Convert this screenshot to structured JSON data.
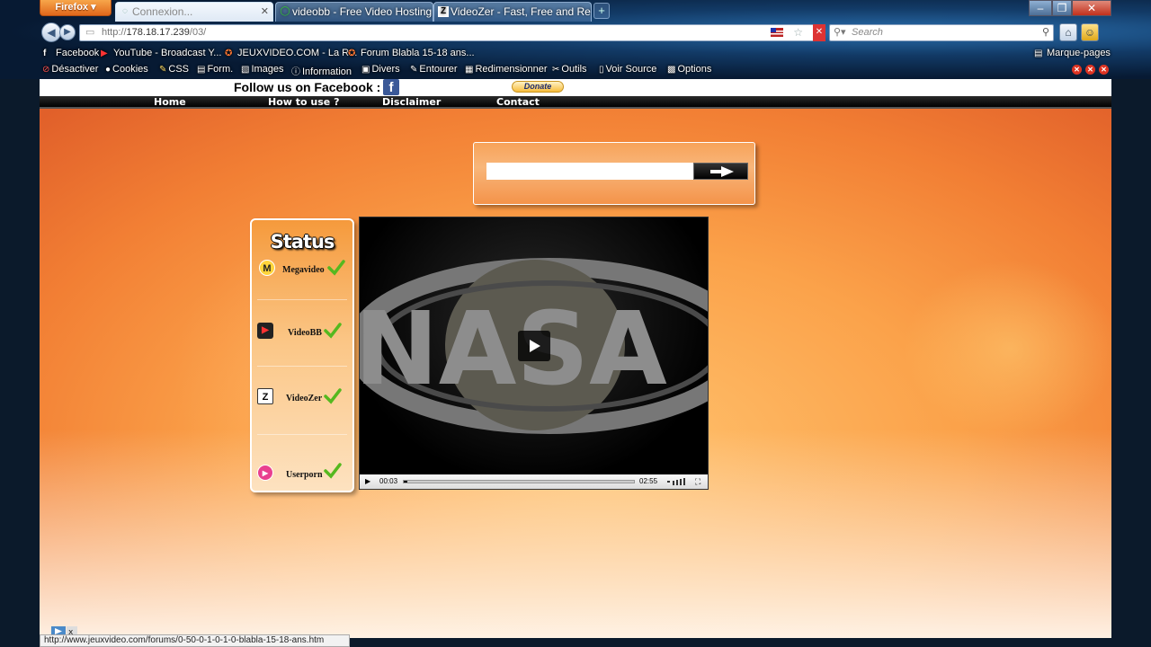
{
  "browser": {
    "app_button": "Firefox",
    "tabs": [
      {
        "title": "Connexion...",
        "icon": "loading-icon",
        "active": true
      },
      {
        "title": "videobb - Free Video Hosting...",
        "icon": "videobb-icon",
        "active": false
      },
      {
        "title": "VideoZer - Fast, Free and Reli...",
        "icon": "videozer-icon",
        "active": false
      }
    ],
    "url_prefix": "http://",
    "url_host": "178.18.17.239",
    "url_path": "/03/",
    "search_placeholder": "Search",
    "bookmarks": [
      {
        "label": "Facebook",
        "icon": "facebook-icon"
      },
      {
        "label": "YouTube - Broadcast Y...",
        "icon": "youtube-icon"
      },
      {
        "label": "JEUXVIDEO.COM - La R...",
        "icon": "jeuxvideo-icon"
      },
      {
        "label": "Forum Blabla 15-18 ans...",
        "icon": "forum-icon"
      }
    ],
    "bookmarks_menu": "Marque-pages",
    "webdev_toolbar": [
      {
        "label": "Désactiver",
        "icon": "disable-icon"
      },
      {
        "label": "Cookies",
        "icon": "cookies-icon"
      },
      {
        "label": "CSS",
        "icon": "css-icon"
      },
      {
        "label": "Form.",
        "icon": "form-icon"
      },
      {
        "label": "Images",
        "icon": "images-icon"
      },
      {
        "label": "Information",
        "icon": "info-icon"
      },
      {
        "label": "Divers",
        "icon": "misc-icon"
      },
      {
        "label": "Entourer",
        "icon": "outline-icon"
      },
      {
        "label": "Redimensionner",
        "icon": "resize-icon"
      },
      {
        "label": "Outils",
        "icon": "tools-icon"
      },
      {
        "label": "Voir Source",
        "icon": "view-source-icon"
      },
      {
        "label": "Options",
        "icon": "options-icon"
      }
    ],
    "status_url": "http://www.jeuxvideo.com/forums/0-50-0-1-0-1-0-blabla-15-18-ans.htm"
  },
  "site": {
    "follow_text": "Follow us on Facebook :",
    "donate_label": "Donate",
    "menu": [
      "Home",
      "How to use ?",
      "Disclaimer",
      "Contact"
    ],
    "search_value": "",
    "status": {
      "title": "Status",
      "hosts": [
        {
          "name": "Megavideo",
          "icon": "megavideo-icon",
          "ok": true
        },
        {
          "name": "VideoBB",
          "icon": "videobb-icon",
          "ok": true
        },
        {
          "name": "VideoZer",
          "icon": "videozer-icon",
          "ok": true
        },
        {
          "name": "Userporn",
          "icon": "userporn-icon",
          "ok": true
        }
      ]
    },
    "player": {
      "watermark": "NASA",
      "current_time": "00:03",
      "duration": "02:55",
      "progress": 0.017
    }
  },
  "colors": {
    "page_orange": "#f7923f",
    "menu_black": "#000000",
    "facebook_blue": "#3b5998",
    "check_green": "#55b81f"
  }
}
